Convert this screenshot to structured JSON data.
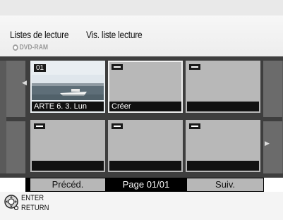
{
  "header": {
    "title": "Listes de lecture",
    "subtitle": "Vis. liste lecture",
    "media": "DVD-RAM",
    "media_icon": "disc-icon"
  },
  "grid": {
    "tiles": [
      {
        "number": "01",
        "caption": "ARTE   6. 3. Lun",
        "has_picture": true,
        "selected": false
      },
      {
        "number": "",
        "caption": "Créer",
        "has_picture": false,
        "selected": true
      },
      {
        "number": "",
        "caption": "",
        "has_picture": false,
        "selected": false
      },
      {
        "number": "",
        "caption": "",
        "has_picture": false,
        "selected": false
      },
      {
        "number": "",
        "caption": "",
        "has_picture": false,
        "selected": false
      },
      {
        "number": "",
        "caption": "",
        "has_picture": false,
        "selected": false
      }
    ]
  },
  "nav": {
    "prev_label": "Précéd.",
    "page_label": "Page 01/01",
    "next_label": "Suiv."
  },
  "footer": {
    "enter_label": "ENTER",
    "return_label": "RETURN",
    "icon": "remote-dial-icon"
  },
  "colors": {
    "grid_bg": "#3e3e3e",
    "tile_empty": "#b8b8b8",
    "button_bg": "#b7b7b7"
  }
}
